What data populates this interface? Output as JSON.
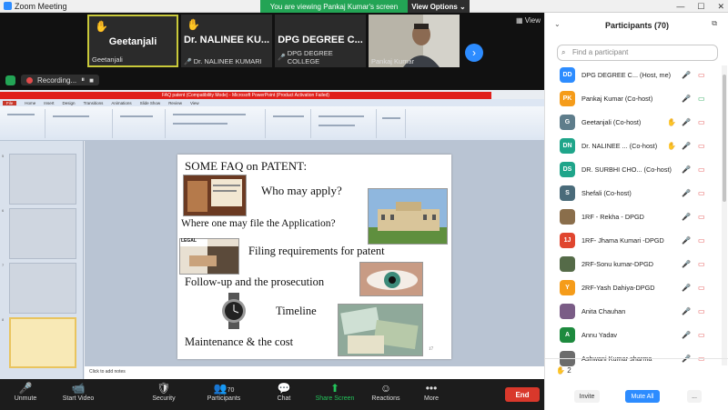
{
  "window": {
    "title": "Zoom Meeting",
    "controls": [
      "—",
      "☐",
      "✕"
    ]
  },
  "banner": {
    "viewing": "You are viewing Pankaj Kumar's screen",
    "view_options": "View Options ⌄"
  },
  "video_strip": {
    "tiles": [
      {
        "display": "Geetanjali",
        "footer": "Geetanjali",
        "hand": true,
        "muted": false,
        "active": true
      },
      {
        "display": "Dr. NALINEE KU...",
        "footer": "Dr. NALINEE KUMARI",
        "hand": true,
        "muted": true,
        "active": false
      },
      {
        "display": "DPG DEGREE C...",
        "footer": "DPG DEGREE COLLEGE",
        "hand": false,
        "muted": true,
        "active": false
      },
      {
        "display": "",
        "footer": "Pankaj Kumar",
        "hand": false,
        "muted": false,
        "active": false
      }
    ],
    "view_label": "View",
    "recording_label": "Recording..."
  },
  "shared_screen": {
    "ppt_title": "FAQ patent (Compatibility Mode) - Microsoft PowerPoint (Product Activation Failed)",
    "ribbon_tabs": [
      "File",
      "Home",
      "Insert",
      "Design",
      "Transitions",
      "Animations",
      "Slide Show",
      "Review",
      "View"
    ],
    "thumb_numbers": [
      "5",
      "6",
      "7",
      "8",
      "9"
    ],
    "notes_placeholder": "Click to add notes",
    "slide": {
      "heading": "SOME FAQ on PATENT:",
      "q1": "Who may apply?",
      "q2": "Where one may file the Application?",
      "legal": "LEGAL",
      "q3": "Filing requirements for patent",
      "q4": "Follow-up and the prosecution",
      "q5": "Timeline",
      "q6": "Maintenance & the cost",
      "slide_no": "17"
    }
  },
  "toolbar": {
    "unmute": "Unmute",
    "start_video": "Start Video",
    "security": "Security",
    "participants": "Participants",
    "participants_count": "70",
    "chat": "Chat",
    "share_screen": "Share Screen",
    "reactions": "Reactions",
    "more": "More",
    "end": "End"
  },
  "panel": {
    "title": "Participants (70)",
    "search_placeholder": "Find a participant",
    "participants": [
      {
        "initials": "DD",
        "name": "DPG DEGREE C...  (Host, me)",
        "color": "#2d8cff",
        "hand": false,
        "video_off": true
      },
      {
        "initials": "PK",
        "name": "Pankaj Kumar (Co-host)",
        "color": "#f59c1a",
        "hand": false,
        "video_off": false
      },
      {
        "initials": "G",
        "name": "Geetanjali (Co-host)",
        "color": "#5e7d8b",
        "hand": true,
        "video_off": true
      },
      {
        "initials": "DN",
        "name": "Dr. NALINEE ... (Co-host)",
        "color": "#1fa58a",
        "hand": true,
        "video_off": true
      },
      {
        "initials": "DS",
        "name": "DR. SURBHI CHO... (Co-host)",
        "color": "#1fa58a",
        "hand": false,
        "video_off": true
      },
      {
        "initials": "S",
        "name": "Shefali (Co-host)",
        "color": "#4a6b7a",
        "hand": false,
        "video_off": true
      },
      {
        "initials": "",
        "name": "1RF - Rekha - DPGD",
        "color": "#8a6e4b",
        "hand": false,
        "video_off": true
      },
      {
        "initials": "1J",
        "name": "1RF- Jhama Kumari -DPGD",
        "color": "#e0462f",
        "hand": false,
        "video_off": true
      },
      {
        "initials": "",
        "name": "2RF-Sonu kumar-DPGD",
        "color": "#556b48",
        "hand": false,
        "video_off": true
      },
      {
        "initials": "Y",
        "name": "2RF-Yash Dahiya-DPGD",
        "color": "#f59c1a",
        "hand": false,
        "video_off": true
      },
      {
        "initials": "",
        "name": "Anita Chauhan",
        "color": "#7a5c86",
        "hand": false,
        "video_off": true
      },
      {
        "initials": "A",
        "name": "Annu Yadav",
        "color": "#1d8a3e",
        "hand": false,
        "video_off": true
      },
      {
        "initials": "",
        "name": "Ashwani Kumar sharma",
        "color": "#6c6c6c",
        "hand": false,
        "video_off": true
      }
    ],
    "raised_count": "2",
    "invite": "Invite",
    "mute_all": "Mute All",
    "more": "..."
  }
}
